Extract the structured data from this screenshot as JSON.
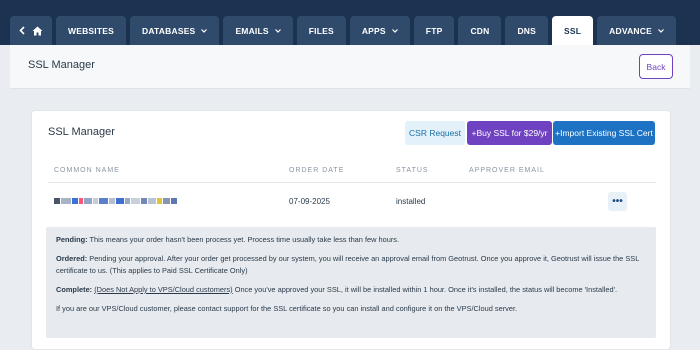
{
  "nav": {
    "tabs": [
      {
        "label": "WEBSITES"
      },
      {
        "label": "DATABASES"
      },
      {
        "label": "EMAILS"
      },
      {
        "label": "FILES"
      },
      {
        "label": "APPS"
      },
      {
        "label": "FTP"
      },
      {
        "label": "CDN"
      },
      {
        "label": "DNS"
      },
      {
        "label": "SSL"
      },
      {
        "label": "ADVANCE"
      }
    ],
    "active_tab": "SSL",
    "back_icon": "chevron-left-icon",
    "home_icon": "home-icon"
  },
  "header": {
    "title": "SSL Manager",
    "back_label": "Back"
  },
  "card": {
    "title": "SSL Manager",
    "csr_label": "CSR Request",
    "buy_label": "+Buy SSL for $29/yr",
    "import_label": "+Import Existing SSL Cert"
  },
  "table": {
    "headers": [
      "COMMON NAME",
      "ORDER DATE",
      "STATUS",
      "APPROVER EMAIL"
    ],
    "rows": [
      {
        "common_name": "[redacted]",
        "order_date": "07-09-2025",
        "status": "installed",
        "approver_email": "",
        "more": "•••"
      }
    ]
  },
  "info": {
    "pending_label": "Pending:",
    "pending_text": " This means your order hasn't been process yet. Process time usually take less than few hours.",
    "ordered_label": "Ordered:",
    "ordered_text": " Pending your approval. After your order get processed by our system, you will receive an approval email from Geotrust. Once you approve it, Geotrust will issue the SSL certificate to us. (This applies to Paid SSL Certificate Only)",
    "complete_label": "Complete:",
    "complete_note": "(Does Not Apply to VPS/Cloud customers)",
    "complete_text": " Once you've approved your SSL, it will be installed within 1 hour. Once it's installed, the status will become 'Installed'.",
    "vps_text": "If you are our VPS/Cloud customer, please contact support for the SSL certificate so you can install and configure it on the VPS/Cloud server."
  },
  "colors": {
    "nav_bg": "#1b3350",
    "tab_bg": "#2f4a6b",
    "accent_purple": "#6f42c1",
    "accent_blue": "#1d72c4",
    "csr_bg": "#e3f1fb"
  }
}
